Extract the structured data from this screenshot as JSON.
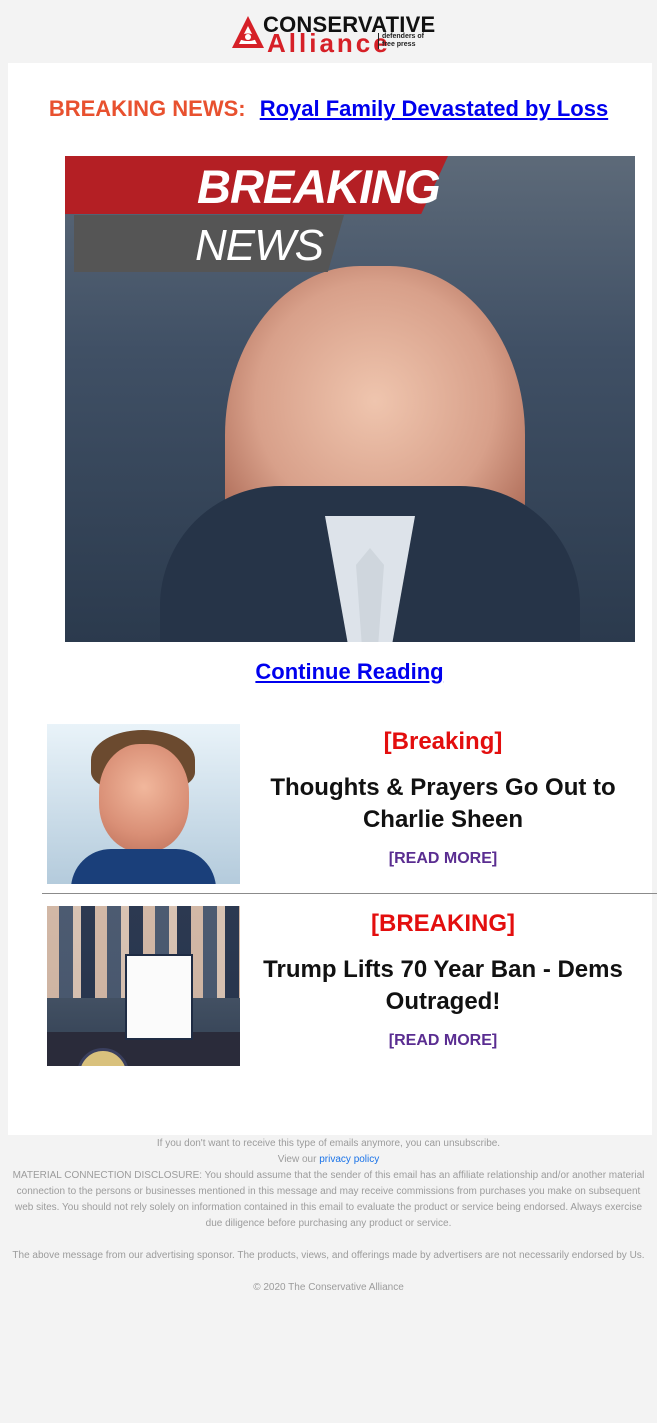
{
  "header": {
    "brand_top": "CONSERVATIVE",
    "brand_bottom": "Alliance",
    "tagline_1": "defenders of",
    "tagline_2": "free press"
  },
  "headline": {
    "label": "BREAKING NEWS:",
    "link_text": "Royal Family Devastated by Loss"
  },
  "hero": {
    "breaking_word": "BREAKING",
    "news_word": "NEWS"
  },
  "continue": {
    "text": "Continue Reading"
  },
  "stories": [
    {
      "tag": "[Breaking]",
      "title": "Thoughts & Prayers Go Out to Charlie Sheen",
      "more": "[READ MORE]"
    },
    {
      "tag": "[BREAKING]",
      "title": "Trump Lifts 70 Year Ban - Dems Outraged!",
      "more": "[READ MORE]"
    }
  ],
  "footer": {
    "unsubscribe": "If you don't want to receive this type of emails anymore, you can unsubscribe.",
    "view_prefix": "View our",
    "privacy_link": "privacy policy",
    "disclosure": "MATERIAL CONNECTION DISCLOSURE: You should assume that the sender of this email has an affiliate relationship and/or another material connection to the persons or businesses mentioned in this message and may receive commissions from purchases you make on subsequent web sites. You should not rely solely on information contained in this email to evaluate the product or service being endorsed. Always exercise due diligence before purchasing any product or service.",
    "sponsor": "The above message from our advertising sponsor. The products, views, and offerings made by advertisers are not necessarily endorsed by Us.",
    "copyright": "© 2020 The Conservative Alliance"
  },
  "colors": {
    "breaking_red": "#e30e0e",
    "headline_orange": "#e8512f",
    "link_blue": "#0000ee",
    "read_more_purple": "#5a2d91"
  }
}
